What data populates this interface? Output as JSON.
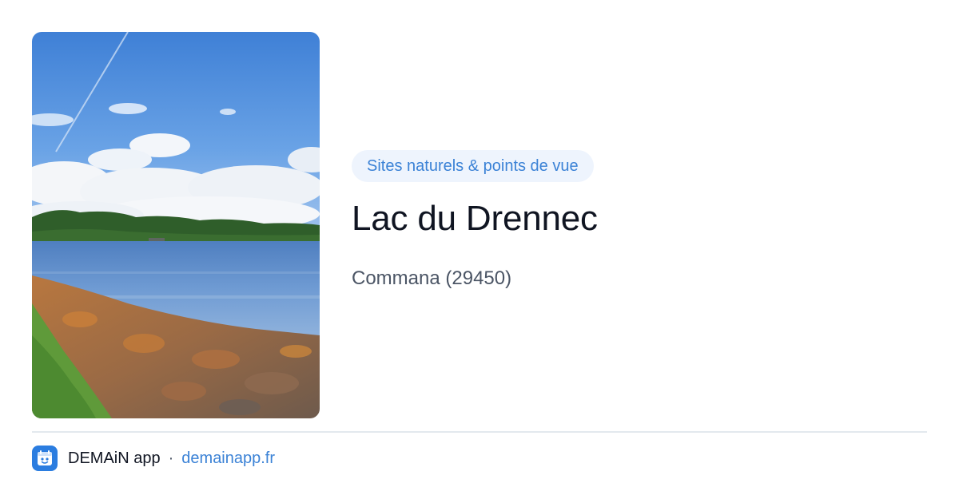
{
  "card": {
    "category": "Sites naturels & points de vue",
    "title": "Lac du Drennec",
    "location": "Commana (29450)"
  },
  "image": {
    "subject": "lake-landscape-photo"
  },
  "footer": {
    "app_name": "DEMAiN app",
    "separator": "·",
    "link": "demainapp.fr",
    "icon": "app-logo-icon"
  },
  "colors": {
    "accent": "#3b82d6",
    "badge_bg": "#eef4fd",
    "title": "#101522",
    "muted": "#4b5565",
    "divider": "#e3e9ee",
    "app_icon_bg": "#2b7de0"
  }
}
